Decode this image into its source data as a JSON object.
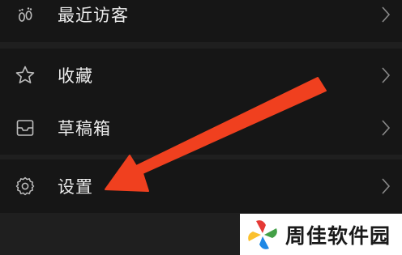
{
  "menu": {
    "recent_visitors": {
      "label": "最近访客",
      "icon": "footprint-icon"
    },
    "favorites": {
      "label": "收藏",
      "icon": "star-icon"
    },
    "drafts": {
      "label": "草稿箱",
      "icon": "inbox-tray-icon"
    },
    "settings": {
      "label": "设置",
      "icon": "gear-icon"
    }
  },
  "annotation": {
    "arrow_color": "#f0401f"
  },
  "watermark": {
    "text": "周佳软件园"
  },
  "colors": {
    "background": "#1f1f1f",
    "row_background": "#161616",
    "text": "#ececec",
    "icon": "#bdbdbd"
  }
}
